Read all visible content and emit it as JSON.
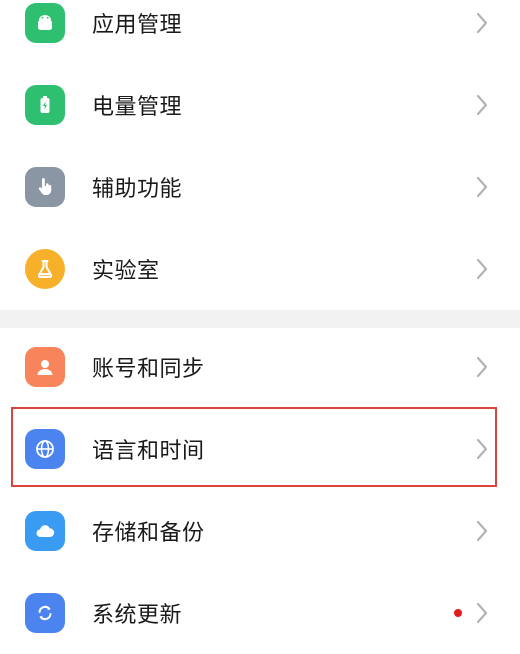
{
  "colors": {
    "app_management": "#2fbf71",
    "battery": "#2fbf71",
    "accessibility": "#8b96a5",
    "lab": "#f6b02a",
    "account": "#f7845a",
    "language": "#4b84ee",
    "storage": "#3a9bf2",
    "update": "#4b84ee",
    "label_text": "#1a1a1a",
    "chevron": "#b3b3b3",
    "badge_dot": "#e21b1b",
    "highlight_border": "#d9463f",
    "section_band": "#f2f2f2"
  },
  "items": [
    {
      "id": "app-management",
      "label": "应用管理",
      "icon": "android-robot-icon"
    },
    {
      "id": "battery",
      "label": "电量管理",
      "icon": "battery-icon"
    },
    {
      "id": "accessibility",
      "label": "辅助功能",
      "icon": "hand-pointer-icon"
    },
    {
      "id": "lab",
      "label": "实验室",
      "icon": "flask-icon"
    },
    {
      "id": "account-sync",
      "label": "账号和同步",
      "icon": "person-icon"
    },
    {
      "id": "language-time",
      "label": "语言和时间",
      "icon": "globe-icon"
    },
    {
      "id": "storage-backup",
      "label": "存储和备份",
      "icon": "cloud-icon"
    },
    {
      "id": "system-update",
      "label": "系统更新",
      "icon": "refresh-icon",
      "has_badge": true
    }
  ]
}
